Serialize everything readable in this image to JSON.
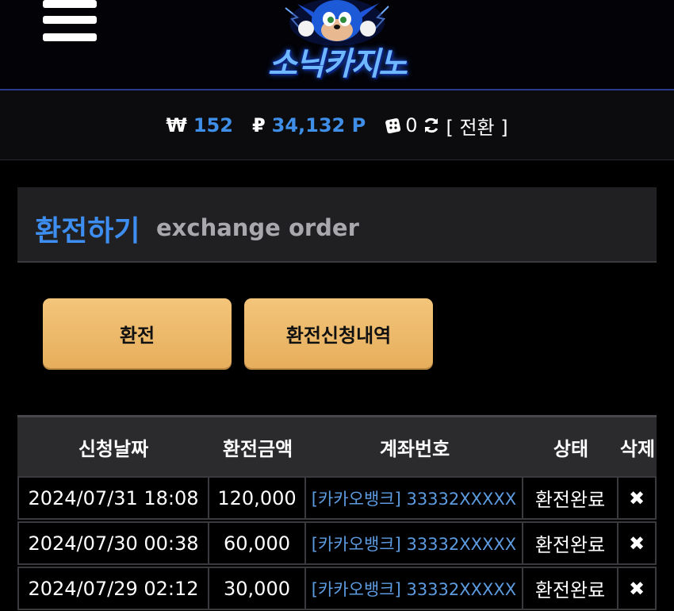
{
  "header": {
    "logo_text": "소닉카지노",
    "menu_icon": "hamburger-menu-icon"
  },
  "balance": {
    "won_symbol": "₩",
    "won_value": "152",
    "point_symbol": "₽",
    "point_value": "34,132 P",
    "chip_value": "0",
    "convert_label": "[ 전환 ]"
  },
  "panel": {
    "title": "환전하기",
    "subtitle": "exchange order"
  },
  "buttons": {
    "exchange": "환전",
    "history": "환전신청내역"
  },
  "table": {
    "headers": [
      "신청날짜",
      "환전금액",
      "계좌번호",
      "상태",
      "삭제"
    ],
    "rows": [
      {
        "date": "2024/07/31 18:08",
        "amount": "120,000",
        "account": "[카카오뱅크] 33332XXXXX",
        "status": "환전완료",
        "delete": "✖"
      },
      {
        "date": "2024/07/30 00:38",
        "amount": "60,000",
        "account": "[카카오뱅크] 33332XXXXX",
        "status": "환전완료",
        "delete": "✖"
      },
      {
        "date": "2024/07/29 02:12",
        "amount": "30,000",
        "account": "[카카오뱅크] 33332XXXXX",
        "status": "환전완료",
        "delete": "✖"
      }
    ]
  },
  "colors": {
    "accent_blue": "#3d8ef0",
    "button_gold": "#efbd6f",
    "header_line": "#2a3a8c"
  }
}
